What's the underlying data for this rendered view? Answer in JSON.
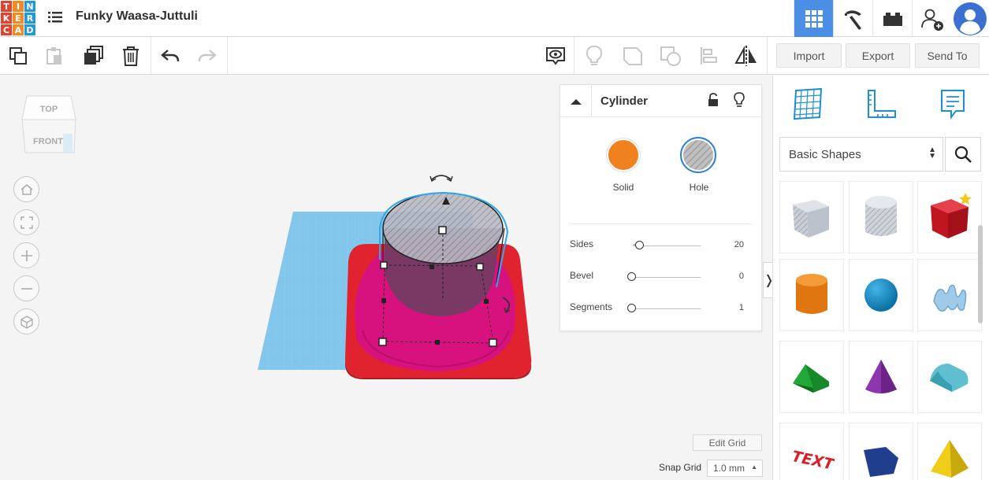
{
  "app": {
    "logo_letters": [
      "T",
      "I",
      "N",
      "K",
      "E",
      "R",
      "C",
      "A",
      "D"
    ],
    "logo_colors": [
      "#e2432f",
      "#f08a24",
      "#1f9ad6",
      "#e2432f",
      "#f08a24",
      "#1f9ad6",
      "#e2432f",
      "#f08a24",
      "#1f9ad6"
    ],
    "design_title": "Funky Waasa-Juttuli"
  },
  "header": {
    "icons": [
      "grid-view-icon",
      "pickaxe-icon",
      "bricks-icon",
      "add-user-icon",
      "user-avatar-icon"
    ],
    "active": "grid-view-icon",
    "accent": "#4a8ee6"
  },
  "toolbar": {
    "left_icons": [
      "copy-icon",
      "paste-icon",
      "duplicate-icon",
      "delete-icon",
      "undo-icon",
      "redo-icon"
    ],
    "right_icons": [
      "view-notes-icon",
      "light-bulb-icon",
      "group-icon",
      "ungroup-icon",
      "align-icon",
      "mirror-icon"
    ],
    "import_label": "Import",
    "export_label": "Export",
    "send_label": "Send To"
  },
  "viewcube": {
    "top_label": "TOP",
    "front_label": "FRONT"
  },
  "nav_buttons": [
    "home-view-icon",
    "fit-view-icon",
    "zoom-in-icon",
    "zoom-out-icon",
    "perspective-icon"
  ],
  "workplane": {
    "label": "Workplane",
    "color": "#58b7e8"
  },
  "inspector": {
    "title": "Cylinder",
    "solid_label": "Solid",
    "hole_label": "Hole",
    "solid_color": "#f0811f",
    "properties": [
      {
        "label": "Sides",
        "value": "20",
        "min_text": "-",
        "level": 0.12
      },
      {
        "label": "Bevel",
        "value": "0",
        "min_text": "",
        "level": 0
      },
      {
        "label": "Segments",
        "value": "1",
        "min_text": "",
        "level": 0
      }
    ]
  },
  "right_panel": {
    "tools": [
      "workplane-icon",
      "ruler-icon",
      "notes-icon"
    ],
    "category": "Basic Shapes",
    "shapes": [
      "box-hole",
      "cylinder-hole",
      "box",
      "cylinder",
      "sphere",
      "scribble",
      "roof",
      "cone",
      "round-roof",
      "text",
      "polygon",
      "pyramid"
    ]
  },
  "bottom": {
    "edit_grid_label": "Edit Grid",
    "snap_label": "Snap Grid",
    "snap_value": "1.0 mm"
  }
}
